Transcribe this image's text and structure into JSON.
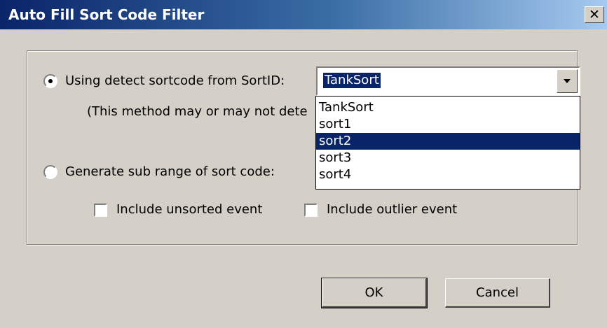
{
  "window": {
    "title": "Auto Fill Sort Code Filter",
    "close_label": "x"
  },
  "options": {
    "detect_label": "Using detect sortcode from SortID:",
    "detect_note": "(This method may or may not dete",
    "subrange_label": "Generate sub range of sort code:",
    "detect_selected": true
  },
  "sortid": {
    "value": "TankSort",
    "items": [
      "TankSort",
      "sort1",
      "sort2",
      "sort3",
      "sort4"
    ],
    "highlighted": "sort2"
  },
  "checkboxes": {
    "unsorted_label": "Include unsorted event",
    "outlier_label": "Include outlier event"
  },
  "buttons": {
    "ok": "OK",
    "cancel": "Cancel"
  }
}
